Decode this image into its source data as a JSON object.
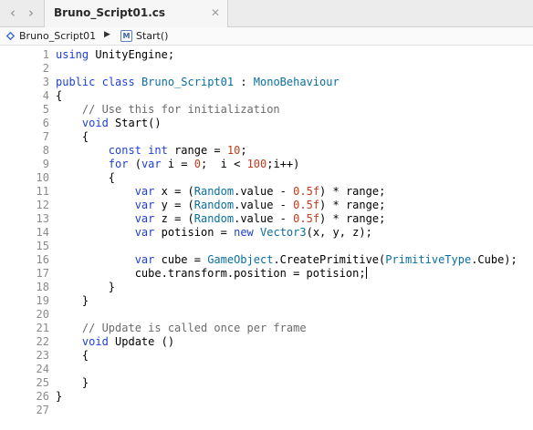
{
  "tab": {
    "title": "Bruno_Script01.cs",
    "close_glyph": "✕"
  },
  "nav": {
    "back_glyph": "‹",
    "forward_glyph": "›"
  },
  "breadcrumb": {
    "file": "Bruno_Script01",
    "method_icon_letter": "M",
    "method": "Start()",
    "separator_glyph": "▶"
  },
  "colors": {
    "keyword": "#1d3fd6",
    "type": "#0a6ea1",
    "number": "#c23a1b",
    "comment": "#6b6b6b",
    "line_number": "#8b8b8b"
  },
  "editor": {
    "cursor_line": 17,
    "lines": [
      {
        "n": "1",
        "t": [
          [
            "kw",
            "using"
          ],
          [
            "",
            " UnityEngine;"
          ]
        ]
      },
      {
        "n": "2",
        "t": []
      },
      {
        "n": "3",
        "t": [
          [
            "kw",
            "public"
          ],
          [
            "",
            " "
          ],
          [
            "kw",
            "class"
          ],
          [
            "",
            ""
          ],
          [
            "ty",
            " Bruno_Script01"
          ],
          [
            "",
            " : "
          ],
          [
            "ty",
            "MonoBehaviour"
          ]
        ]
      },
      {
        "n": "4",
        "t": [
          [
            "",
            "{"
          ]
        ]
      },
      {
        "n": "5",
        "t": [
          [
            "",
            "    "
          ],
          [
            "cm",
            "// Use this for initialization"
          ]
        ]
      },
      {
        "n": "6",
        "t": [
          [
            "",
            "    "
          ],
          [
            "kw",
            "void"
          ],
          [
            "",
            " Start()"
          ]
        ]
      },
      {
        "n": "7",
        "t": [
          [
            "",
            "    {"
          ]
        ]
      },
      {
        "n": "8",
        "t": [
          [
            "",
            "        "
          ],
          [
            "kw",
            "const"
          ],
          [
            "",
            " "
          ],
          [
            "kw",
            "int"
          ],
          [
            "",
            " range = "
          ],
          [
            "num",
            "10"
          ],
          [
            "",
            ";"
          ]
        ]
      },
      {
        "n": "9",
        "t": [
          [
            "",
            "        "
          ],
          [
            "kw",
            "for"
          ],
          [
            "",
            " ("
          ],
          [
            "kw",
            "var"
          ],
          [
            "",
            " i = "
          ],
          [
            "num",
            "0"
          ],
          [
            "",
            ";  i < "
          ],
          [
            "num",
            "100"
          ],
          [
            "",
            ";i++)"
          ]
        ]
      },
      {
        "n": "10",
        "t": [
          [
            "",
            "        {"
          ]
        ]
      },
      {
        "n": "11",
        "t": [
          [
            "",
            "            "
          ],
          [
            "kw",
            "var"
          ],
          [
            "",
            " x = ("
          ],
          [
            "ty",
            "Random"
          ],
          [
            "",
            ".value - "
          ],
          [
            "num",
            "0.5f"
          ],
          [
            "",
            ") * range;"
          ]
        ]
      },
      {
        "n": "12",
        "t": [
          [
            "",
            "            "
          ],
          [
            "kw",
            "var"
          ],
          [
            "",
            " y = ("
          ],
          [
            "ty",
            "Random"
          ],
          [
            "",
            ".value - "
          ],
          [
            "num",
            "0.5f"
          ],
          [
            "",
            ") * range;"
          ]
        ]
      },
      {
        "n": "13",
        "t": [
          [
            "",
            "            "
          ],
          [
            "kw",
            "var"
          ],
          [
            "",
            " z = ("
          ],
          [
            "ty",
            "Random"
          ],
          [
            "",
            ".value - "
          ],
          [
            "num",
            "0.5f"
          ],
          [
            "",
            ") * range;"
          ]
        ]
      },
      {
        "n": "14",
        "t": [
          [
            "",
            "            "
          ],
          [
            "kw",
            "var"
          ],
          [
            "",
            " potision = "
          ],
          [
            "kw",
            "new"
          ],
          [
            "",
            " "
          ],
          [
            "ty",
            "Vector3"
          ],
          [
            "",
            "(x, y, z);"
          ]
        ]
      },
      {
        "n": "15",
        "t": []
      },
      {
        "n": "16",
        "t": [
          [
            "",
            "            "
          ],
          [
            "kw",
            "var"
          ],
          [
            "",
            " cube = "
          ],
          [
            "ty",
            "GameObject"
          ],
          [
            "",
            ".CreatePrimitive("
          ],
          [
            "ty",
            "PrimitiveType"
          ],
          [
            "",
            ".Cube);"
          ]
        ]
      },
      {
        "n": "17",
        "t": [
          [
            "",
            "            cube.transform.position = potision;"
          ]
        ]
      },
      {
        "n": "18",
        "t": [
          [
            "",
            "        }"
          ]
        ]
      },
      {
        "n": "19",
        "t": [
          [
            "",
            "    }"
          ]
        ]
      },
      {
        "n": "20",
        "t": []
      },
      {
        "n": "21",
        "t": [
          [
            "",
            "    "
          ],
          [
            "cm",
            "// Update is called once per frame"
          ]
        ]
      },
      {
        "n": "22",
        "t": [
          [
            "",
            "    "
          ],
          [
            "kw",
            "void"
          ],
          [
            "",
            " Update ()"
          ]
        ]
      },
      {
        "n": "23",
        "t": [
          [
            "",
            "    {"
          ]
        ]
      },
      {
        "n": "24",
        "t": []
      },
      {
        "n": "25",
        "t": [
          [
            "",
            "    }"
          ]
        ]
      },
      {
        "n": "26",
        "t": [
          [
            "",
            "}"
          ]
        ]
      },
      {
        "n": "27",
        "t": []
      }
    ]
  }
}
